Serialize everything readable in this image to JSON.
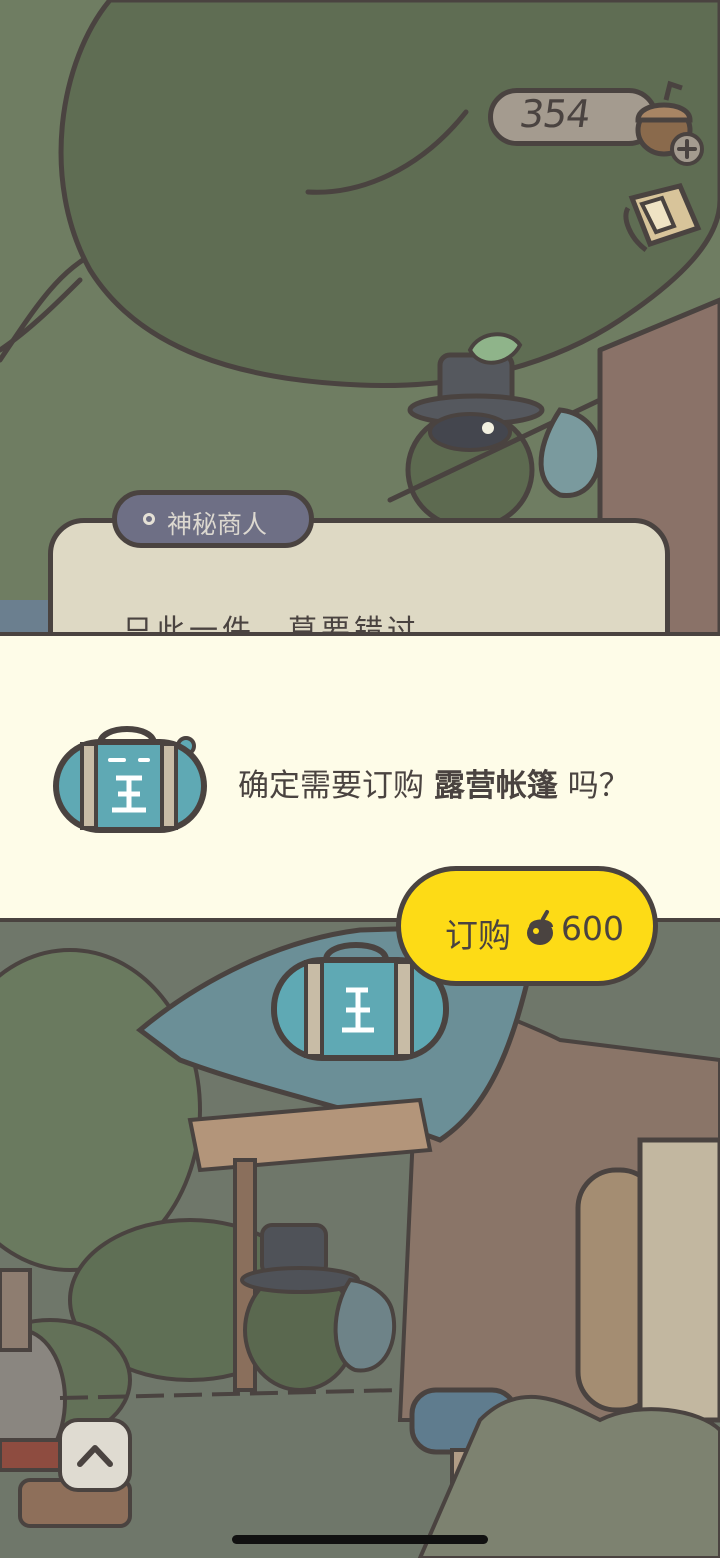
{
  "currency": {
    "amount": "354",
    "icon": "acorn-icon",
    "add_icon": "plus-icon"
  },
  "merchant": {
    "name": "神秘商人",
    "dialog": "只此一件，莫要错过"
  },
  "confirm": {
    "prefix": "确定需要订购",
    "item_name": "露营帐篷",
    "suffix": "吗？",
    "item_icon": "duffel-bag-icon"
  },
  "buy_button": {
    "label": "订购",
    "price": "600",
    "icon": "acorn-icon"
  },
  "colors": {
    "button_yellow": "#fddb16",
    "panel_cream": "#fefce8",
    "ink": "#4a4340",
    "bag_teal": "#5fa9b4"
  }
}
